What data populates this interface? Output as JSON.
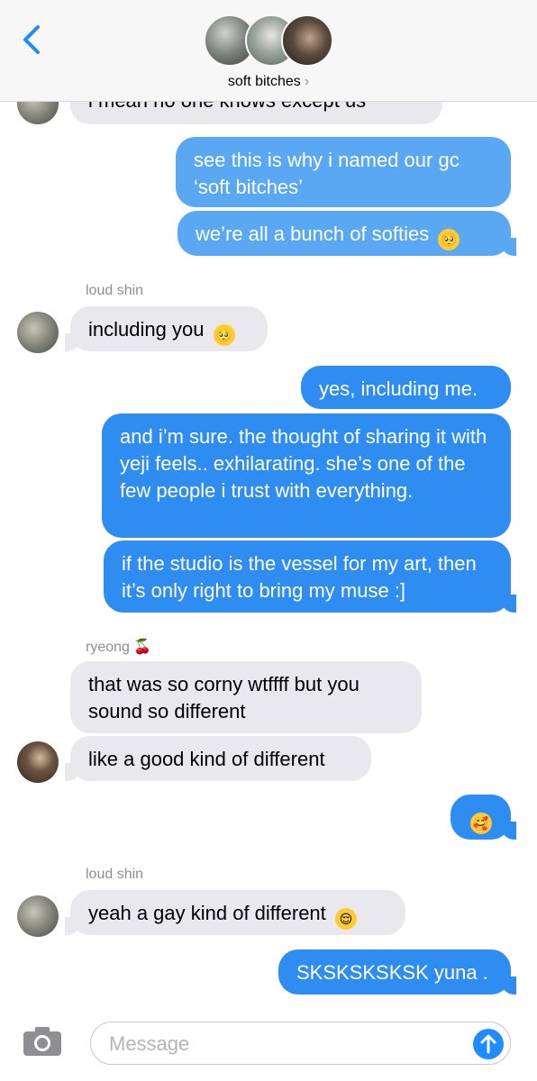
{
  "header": {
    "title": "soft bitches",
    "chevron": "›"
  },
  "messages": [
    {
      "id": "m0",
      "text": "i mean no one knows except us",
      "dir": "in"
    },
    {
      "id": "m1",
      "text": "see this is why i named our gc ‘soft bitches’",
      "dir": "out"
    },
    {
      "id": "m2",
      "text": "we’re all a bunch of softies",
      "emoji": "🥺",
      "dir": "out"
    },
    {
      "id": "m3",
      "sender": "loud shin",
      "text": "including you",
      "emoji": "🥺",
      "dir": "in"
    },
    {
      "id": "m4",
      "text": "yes, including me.",
      "dir": "out"
    },
    {
      "id": "m5",
      "text": "and i’m sure. the thought of sharing it with yeji feels.. exhilarating. she’s one of the few people i trust with everything.",
      "dir": "out"
    },
    {
      "id": "m6",
      "text": "if the studio is the vessel for my art, then it’s only right to bring my muse :]",
      "dir": "out"
    },
    {
      "id": "m7",
      "sender": "ryeong 🍒",
      "text": "that was so corny wtffff but you sound so different",
      "dir": "in"
    },
    {
      "id": "m8",
      "text": "like a good kind of different",
      "dir": "in"
    },
    {
      "id": "m9",
      "emoji": "🥰",
      "dir": "out"
    },
    {
      "id": "m10",
      "sender": "loud shin",
      "text": "yeah a gay kind of different",
      "emoji": "😌",
      "dir": "in"
    },
    {
      "id": "m11",
      "text": "SKSKSKSKSK yuna .",
      "dir": "out"
    }
  ],
  "composer": {
    "placeholder": "Message"
  },
  "colors": {
    "outgoing": "#2f8cf0",
    "incoming": "#e8e8ed",
    "accent": "#1f8dff"
  },
  "icons": {
    "back": "chevron-left-icon",
    "camera": "camera-icon",
    "send": "arrow-up-icon"
  }
}
